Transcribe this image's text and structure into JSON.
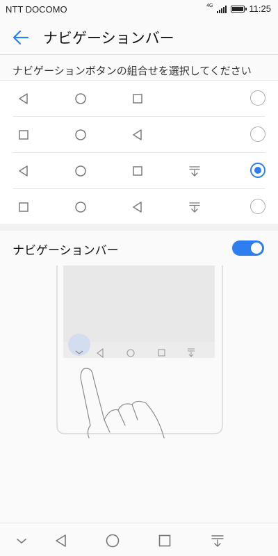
{
  "status_bar": {
    "carrier": "NTT DOCOMO",
    "network": "4G",
    "time": "11:25"
  },
  "header": {
    "title": "ナビゲーションバー",
    "back_icon": "arrow-left-icon"
  },
  "combination_section": {
    "label": "ナビゲーションボタンの組合せを選択してください",
    "options": [
      {
        "icons": [
          "back-triangle-icon",
          "home-circle-icon",
          "recents-square-icon"
        ],
        "selected": false
      },
      {
        "icons": [
          "recents-square-icon",
          "home-circle-icon",
          "back-triangle-icon"
        ],
        "selected": false
      },
      {
        "icons": [
          "back-triangle-icon",
          "home-circle-icon",
          "recents-square-icon",
          "notification-pull-icon"
        ],
        "selected": true
      },
      {
        "icons": [
          "recents-square-icon",
          "home-circle-icon",
          "back-triangle-icon",
          "notification-pull-icon"
        ],
        "selected": false
      }
    ]
  },
  "navigation_bar_setting": {
    "label": "ナビゲーションバー",
    "enabled": true
  },
  "bottom_nav": {
    "icons": [
      "hide-chevron-icon",
      "back-triangle-icon",
      "home-circle-icon",
      "recents-square-icon",
      "notification-pull-icon"
    ]
  },
  "colors": {
    "accent": "#2f7ef0",
    "icon_gray": "#7a7a7a"
  }
}
